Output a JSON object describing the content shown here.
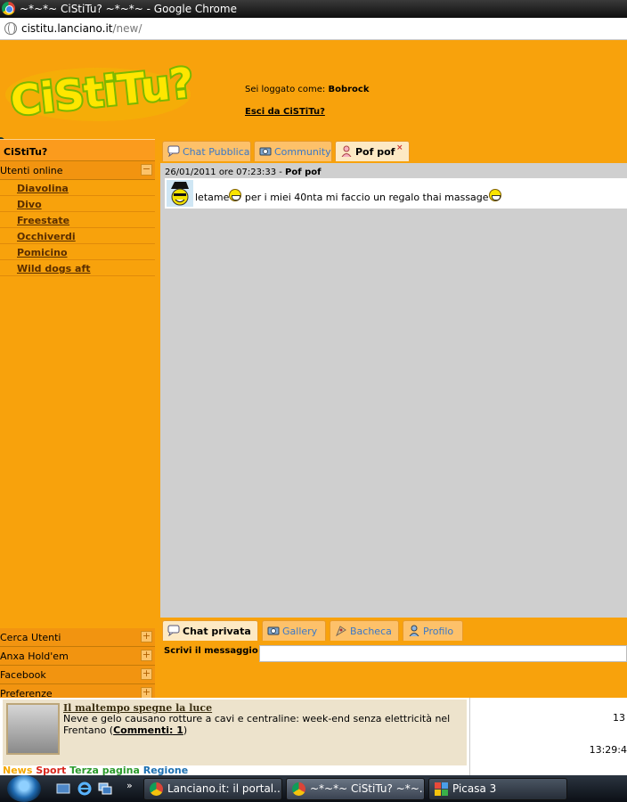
{
  "window": {
    "title": "~*~*~ CiStiTu? ~*~*~ - Google Chrome"
  },
  "addressbar": {
    "url_host": "cistitu.lanciano.it",
    "url_path": "/new/"
  },
  "header": {
    "logo_text": "CiStiTu?",
    "logged_prefix": "Sei loggato come:",
    "username": "Bobrock",
    "logout_label": "Esci da CiSTiTu?"
  },
  "sidebar": {
    "title": "CiStiTu?",
    "online_section": "Utenti online",
    "online_toggle": "−",
    "users": [
      "Diavolina",
      "Divo",
      "Freestate",
      "Occhiverdi",
      "Pomicino",
      "Wild dogs aft"
    ],
    "bottom_sections": [
      {
        "label": "Cerca Utenti",
        "toggle": "+"
      },
      {
        "label": "Anxa Hold'em",
        "toggle": "+"
      },
      {
        "label": "Facebook",
        "toggle": "+"
      },
      {
        "label": "Preferenze",
        "toggle": "+"
      }
    ]
  },
  "top_tabs": [
    {
      "label": "Chat Pubblica",
      "icon": "speech-bubble-icon"
    },
    {
      "label": "Community",
      "icon": "camera-icon"
    },
    {
      "label": "Pof pof",
      "icon": "user-female-icon",
      "close": "×"
    }
  ],
  "chat": {
    "timestamp": "26/01/2011 ore 07:23:33 -",
    "sender": "Pof pof",
    "message_start": "letame",
    "message_end": " per i miei 40nta mi faccio un regalo thai massage"
  },
  "bottom_tabs": [
    {
      "label": "Chat privata",
      "icon": "speech-bubble-icon"
    },
    {
      "label": "Gallery",
      "icon": "camera-icon"
    },
    {
      "label": "Bacheca",
      "icon": "board-icon"
    },
    {
      "label": "Profilo",
      "icon": "user-icon"
    }
  ],
  "compose": {
    "label": "Scrivi il messaggio",
    "value": ""
  },
  "news": {
    "title": "Il maltempo spegne la luce",
    "body": "Neve e gelo causano rotture a cavi e centraline: week-end senza elettricità nel Frentano (",
    "comments_link": "Commenti: 1",
    "body_end": ")",
    "categories": [
      "News",
      "Sport",
      "Terza pagina",
      "Regione"
    ]
  },
  "right_panel": {
    "number": "13",
    "time": "13:29:4"
  },
  "taskbar": {
    "quicklaunch_arrows": "»",
    "buttons": [
      {
        "label": "Lanciano.it: il portal...",
        "icon": "chrome-icon"
      },
      {
        "label": "~*~*~ CiStiTu? ~*~...",
        "icon": "chrome-icon"
      },
      {
        "label": "Picasa 3",
        "icon": "picasa-icon"
      }
    ]
  },
  "colors": {
    "page_orange": "#f8a20c",
    "chat_gray": "#cfcfcf",
    "tab_link_blue": "#3a78c8"
  }
}
